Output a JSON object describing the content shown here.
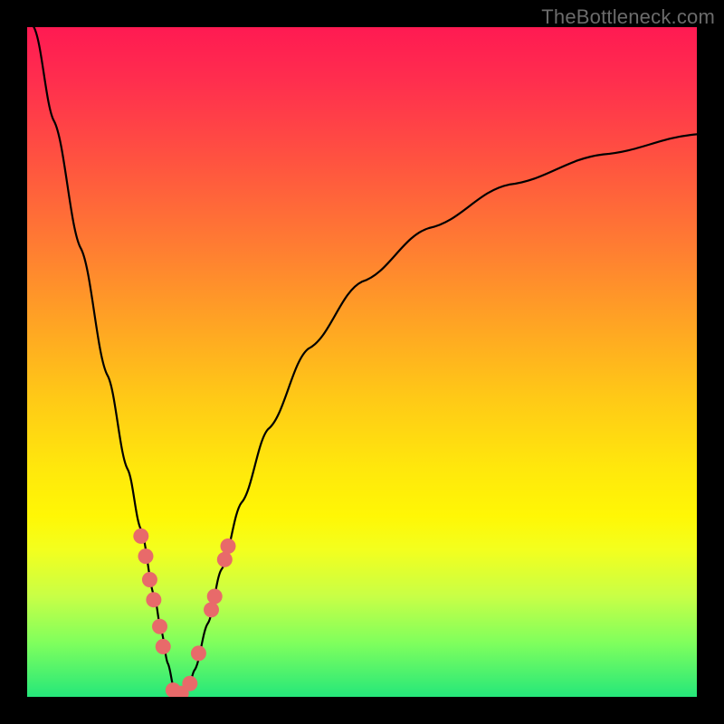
{
  "watermark": "TheBottleneck.com",
  "colors": {
    "dot": "#e86a6a",
    "curve": "#000000"
  },
  "chart_data": {
    "type": "line",
    "title": "",
    "xlabel": "",
    "ylabel": "",
    "xlim": [
      0,
      100
    ],
    "ylim": [
      0,
      100
    ],
    "grid": false,
    "legend": false,
    "note": "Bottleneck-style V curve; y≈0 at minimum (~x=22), rising toward 100 at the edges. Values estimated from pixels.",
    "series": [
      {
        "name": "bottleneck-curve",
        "x": [
          1,
          4,
          8,
          12,
          15,
          17,
          19,
          20,
          21,
          22,
          23,
          24,
          25,
          27,
          29,
          32,
          36,
          42,
          50,
          60,
          72,
          86,
          100
        ],
        "y": [
          100,
          86,
          67,
          48,
          34,
          25,
          15,
          10,
          5,
          1,
          0.5,
          1,
          4,
          11,
          19,
          29,
          40,
          52,
          62,
          70,
          76.5,
          81,
          84
        ]
      }
    ],
    "markers": [
      {
        "x": 17.0,
        "y": 24.0
      },
      {
        "x": 17.7,
        "y": 21.0
      },
      {
        "x": 18.3,
        "y": 17.5
      },
      {
        "x": 18.9,
        "y": 14.5
      },
      {
        "x": 19.8,
        "y": 10.5
      },
      {
        "x": 20.3,
        "y": 7.5
      },
      {
        "x": 21.8,
        "y": 1.0
      },
      {
        "x": 23.0,
        "y": 0.5
      },
      {
        "x": 24.3,
        "y": 2.0
      },
      {
        "x": 25.6,
        "y": 6.5
      },
      {
        "x": 27.5,
        "y": 13.0
      },
      {
        "x": 28.0,
        "y": 15.0
      },
      {
        "x": 29.5,
        "y": 20.5
      },
      {
        "x": 30.0,
        "y": 22.5
      }
    ]
  }
}
